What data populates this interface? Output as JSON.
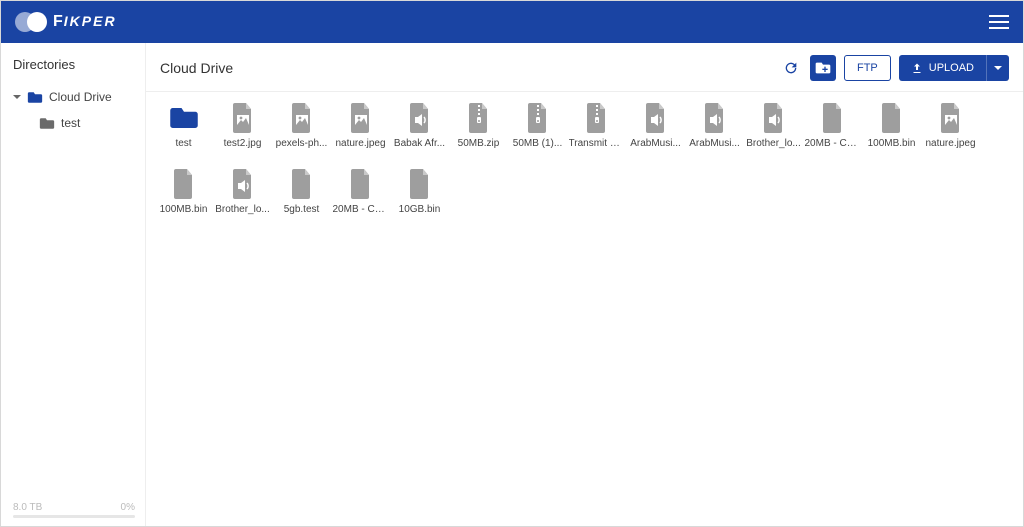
{
  "brand": {
    "name_first": "F",
    "name_rest": "IKPER"
  },
  "sidebar": {
    "title": "Directories",
    "root": {
      "label": "Cloud Drive",
      "expanded": true
    },
    "child": {
      "label": "test"
    },
    "storage": {
      "capacity": "8.0 TB",
      "used_pct": "0%"
    }
  },
  "toolbar": {
    "breadcrumb": "Cloud Drive",
    "ftp_label": "FTP",
    "upload_label": "UPLOAD"
  },
  "items": [
    {
      "name": "test",
      "type": "folder"
    },
    {
      "name": "test2.jpg",
      "type": "image"
    },
    {
      "name": "pexels-ph...",
      "type": "image"
    },
    {
      "name": "nature.jpeg",
      "type": "image"
    },
    {
      "name": "Babak Afr...",
      "type": "audio"
    },
    {
      "name": "50MB.zip",
      "type": "zip"
    },
    {
      "name": "50MB (1)...",
      "type": "zip"
    },
    {
      "name": "Transmit S...",
      "type": "zip"
    },
    {
      "name": "ArabMusi...",
      "type": "audio"
    },
    {
      "name": "ArabMusi...",
      "type": "audio"
    },
    {
      "name": "Brother_lo...",
      "type": "audio"
    },
    {
      "name": "20MB - Co...",
      "type": "file"
    },
    {
      "name": "100MB.bin",
      "type": "file"
    },
    {
      "name": "nature.jpeg",
      "type": "image"
    },
    {
      "name": "100MB.bin",
      "type": "file"
    },
    {
      "name": "Brother_lo...",
      "type": "audio"
    },
    {
      "name": "5gb.test",
      "type": "file"
    },
    {
      "name": "20MB - Co...",
      "type": "file"
    },
    {
      "name": "10GB.bin",
      "type": "file"
    }
  ],
  "icons": {
    "folder_color": "#1a44a3",
    "folder_grey": "#6b6b6b",
    "file_grey": "#9e9e9e"
  }
}
